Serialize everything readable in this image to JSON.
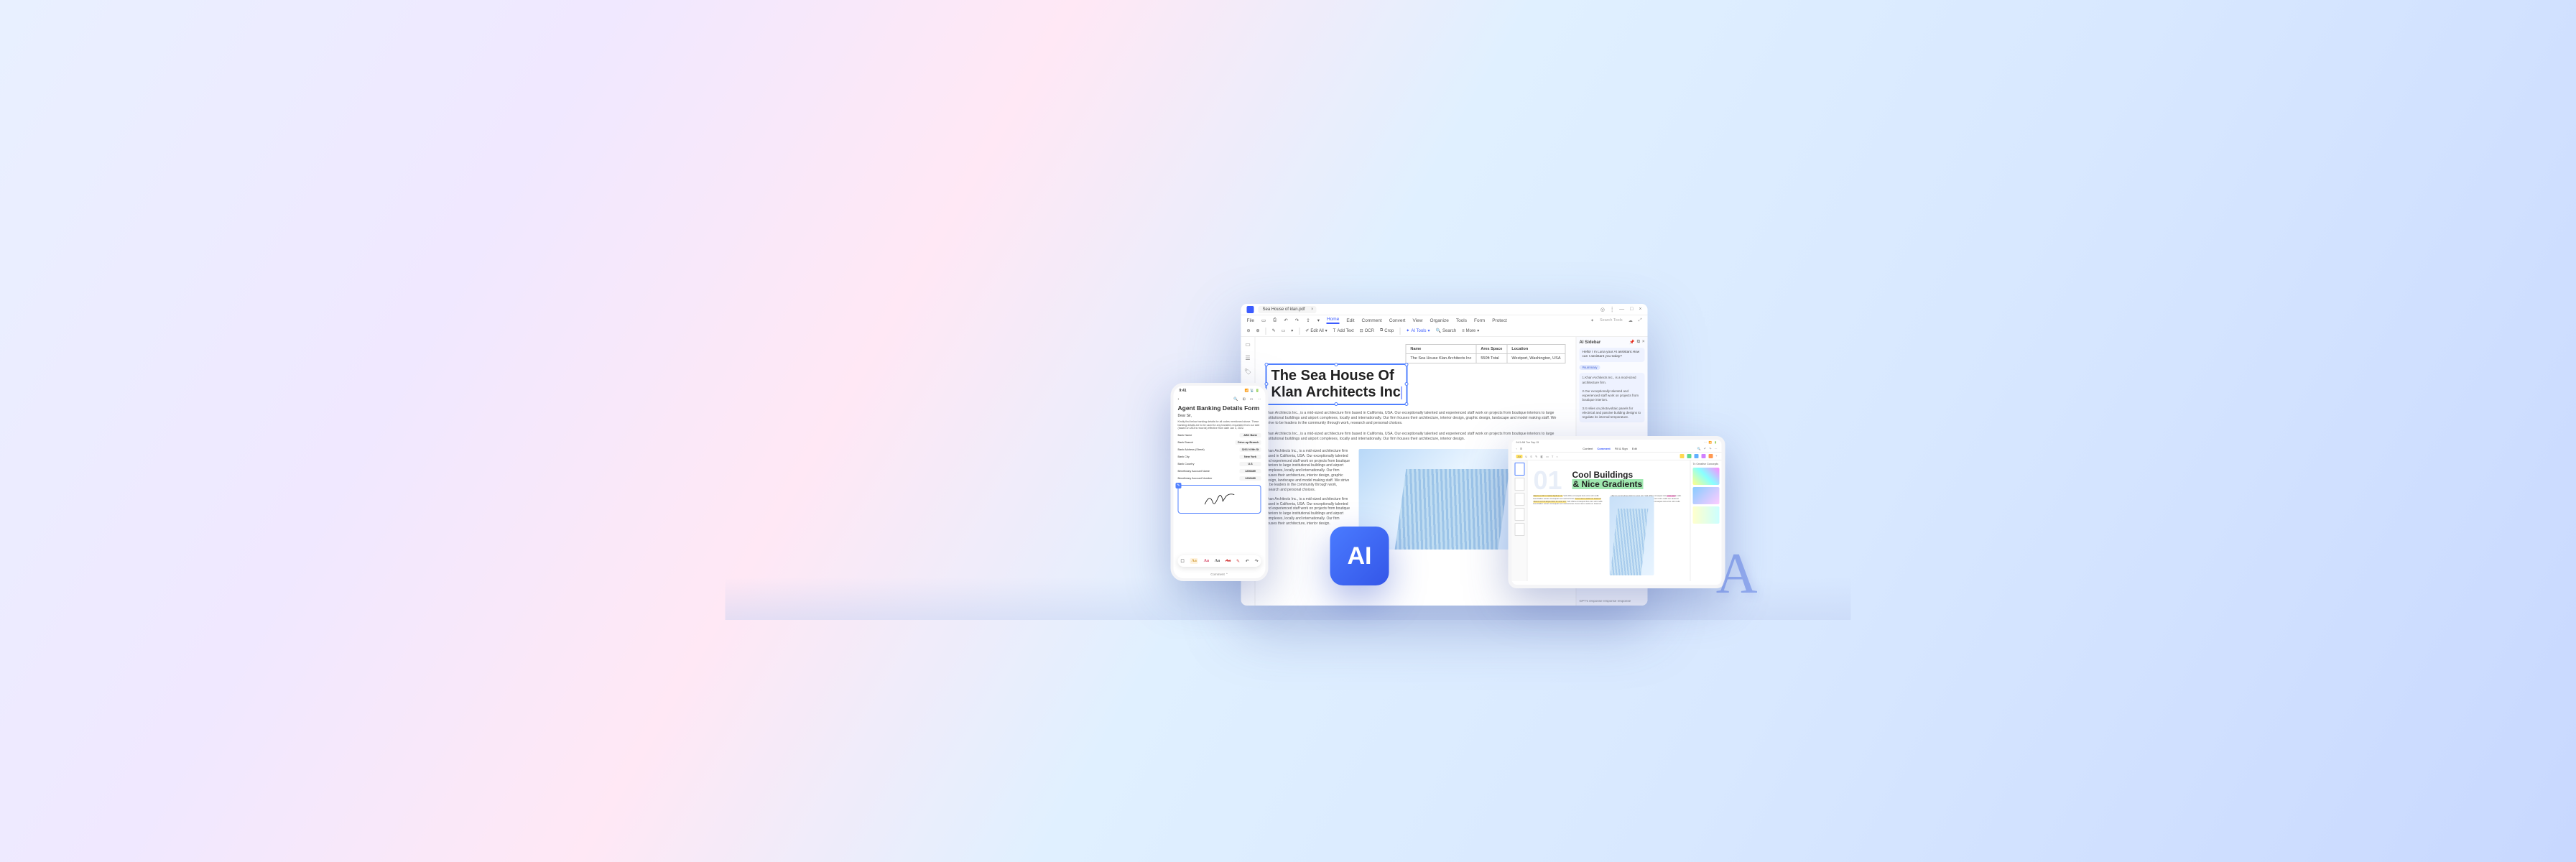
{
  "desktop": {
    "tab_title": "Sea House of klan.pdf",
    "menubar": {
      "file": "File",
      "items": [
        "Home",
        "Edit",
        "Comment",
        "Convert",
        "View",
        "Organize",
        "Tools",
        "Form",
        "Protect"
      ],
      "active_index": 0,
      "search_placeholder": "Search Tools"
    },
    "toolbar": {
      "edit_all": "Edit All",
      "add_text": "Add Text",
      "ocr": "OCR",
      "crop": "Crop",
      "ai_tools": "AI Tools",
      "search": "Search",
      "more": "More"
    },
    "doc": {
      "title_l1": "The Sea House Of",
      "title_l2": "Klan Architects Inc",
      "table": {
        "headers": [
          "Name",
          "Ares Space",
          "Location"
        ],
        "row": [
          "The Sea House Klan Architects Inc",
          "550ft Total",
          "Westport, Washington, USA"
        ]
      },
      "para1": "Khan Architects Inc., is a mid-sized architecture firm based in California, USA. Our exceptionally talented and experienced staff work on projects from boutique interiors to large institutional buildings and airport complexes, locally and internationally. Our firm houses their architecture, interior design, graphic design, landscape and model making staff. We strive to be leaders in the community through work, research and personal choices.",
      "para2": "Khan Architects Inc., is a mid-sized architecture firm based in California, USA. Our exceptionally talented and experienced staff work on projects from boutique interiors to large institutional buildings and airport complexes, locally and internationally. Our firm houses their architecture, interior design.",
      "col1": "Khan Architects Inc., is a mid-sized architecture firm based in California, USA. Our exceptionally talented and experienced staff work on projects from boutique interiors to large institutional buildings and airport complexes, locally and internationally. Our firm houses their architecture, interior design, graphic design, landscape and model making staff. We strive to be leaders in the community through work, research and personal choices.",
      "col2": "Khan Architects Inc., is a mid-sized architecture firm based in California, USA. Our exceptionally talented and experienced staff work on projects from boutique interiors to large institutional buildings and airport complexes, locally and internationally. Our firm houses their architecture, interior design."
    },
    "ai": {
      "title": "AI Sidebar",
      "greeting": "Hello! I m Luna your AI assistant.How can I assistant you today?",
      "tag": "#summary",
      "point1": "1.Khan Architects Inc., is a mod-sized architecture firm.",
      "point2": "2.Our exceptionally talented and experienced staff work on projects from boutique interiors.",
      "point3": "3.It relies on photovoltaic panels for electrical and passive building designs to regulate its internal temperature.",
      "gpt": "GPT's response response response"
    }
  },
  "phone": {
    "time": "9:41",
    "title": "Agent Banking Details Form",
    "dear": "Dear Sir,",
    "intro": "Kindly find below banking details for all codes mentioned above. These banking details are to be used for any transfers requested from our side (based on IATA's records) effective from date Jan 3, 2022.",
    "rows": [
      {
        "label": "Bank Name",
        "value": "ABC Bank"
      },
      {
        "label": "Bank Branch",
        "value": "Drive-up Branch"
      },
      {
        "label": "Bank Address (Street)",
        "value": "3201 N 9th St"
      },
      {
        "label": "Bank City",
        "value": "New York"
      },
      {
        "label": "Bank Country",
        "value": "U.S"
      },
      {
        "label": "Beneficiary Account Name",
        "value": "1206489"
      },
      {
        "label": "Beneficiary Account Number",
        "value": "1206489"
      }
    ],
    "comment": "Comment"
  },
  "ai_icon": "AI",
  "tablet": {
    "time": "9:41 AM Tue Sep 15",
    "tabs": [
      "Content",
      "Comment",
      "Fill & Sign",
      "Edit"
    ],
    "tab_active": 1,
    "big_num": "01",
    "headline_l1": "Cool Buildings",
    "headline_l2": "& Nice Gradients",
    "side_title": "7x Creative Concepts",
    "para": "Velit officia consequat duis enim velit mollit. Mauris eu DIJ s Institut dapibus est. Exercitation veniam consequat sunt nostrud amet. Amet minim mollit non deserunt ullamco est sit aliqua dolor do amet sint. Velit officia consequat duis enim velit mollit. Exercitation veniam consequat sunt nostrud amet. Amet minim mollit non deserunt ullamco est sit aliqua dolor do amet sint. Velit officia consequat duis enim won't mollit. Exercitation veniam consequat sunt nostrud amet."
  },
  "deco": "A"
}
